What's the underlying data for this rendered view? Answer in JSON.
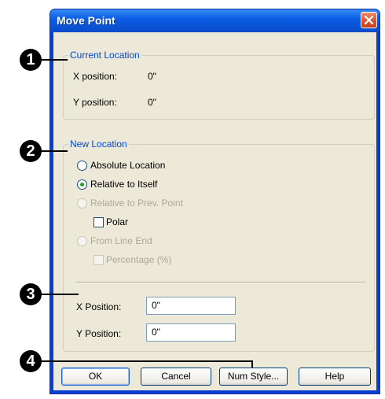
{
  "window": {
    "title": "Move Point",
    "close_icon": "close-x-icon"
  },
  "current_location": {
    "legend": "Current Location",
    "x_label": "X position:",
    "x_value": "0\"",
    "y_label": "Y position:",
    "y_value": "0\""
  },
  "new_location": {
    "legend": "New Location",
    "options": {
      "absolute": "Absolute Location",
      "relative_self": "Relative to Itself",
      "relative_prev": "Relative to Prev. Point",
      "polar": "Polar",
      "line_end": "From Line End",
      "percentage": "Percentage (%)"
    },
    "selected": "Relative to Itself",
    "x_label": "X Position:",
    "x_value": "0\"",
    "y_label": "Y Position:",
    "y_value": "0\""
  },
  "buttons": {
    "ok": "OK",
    "cancel": "Cancel",
    "num_style": "Num Style...",
    "help": "Help"
  },
  "callouts": [
    "1",
    "2",
    "3",
    "4"
  ],
  "colors": {
    "titlebar": "#0a53d4",
    "legend_text": "#0046d5",
    "dialog_bg": "#ece9d8",
    "disabled_text": "#aca899"
  }
}
